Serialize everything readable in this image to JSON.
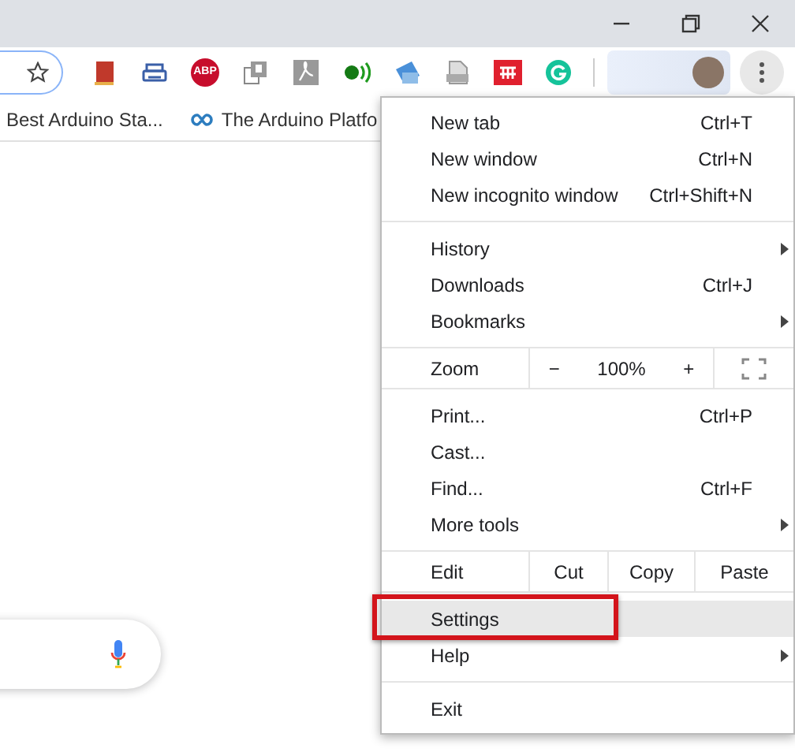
{
  "window_controls": [
    {
      "kind": "minimize"
    },
    {
      "kind": "restore"
    },
    {
      "kind": "close"
    }
  ],
  "toolbar": {
    "extensions": [
      {
        "kind": "book"
      },
      {
        "kind": "printer"
      },
      {
        "kind": "abp",
        "text": "ABP"
      },
      {
        "kind": "frames"
      },
      {
        "kind": "pdf"
      },
      {
        "kind": "signal"
      },
      {
        "kind": "screenshot"
      },
      {
        "kind": "file"
      },
      {
        "kind": "grid"
      },
      {
        "kind": "grammar"
      }
    ]
  },
  "bookmarks": [
    {
      "label": "Best Arduino Sta...",
      "icon": false
    },
    {
      "label": "The Arduino Platfo",
      "icon": true
    }
  ],
  "menu": [
    {
      "kind": "item",
      "label": "New tab",
      "shortcut": "Ctrl+T",
      "submenu": false,
      "selected": false
    },
    {
      "kind": "item",
      "label": "New window",
      "shortcut": "Ctrl+N",
      "submenu": false,
      "selected": false
    },
    {
      "kind": "item",
      "label": "New incognito window",
      "shortcut": "Ctrl+Shift+N",
      "submenu": false,
      "selected": false
    },
    {
      "kind": "separator"
    },
    {
      "kind": "item",
      "label": "History",
      "submenu": true,
      "selected": false
    },
    {
      "kind": "item",
      "label": "Downloads",
      "shortcut": "Ctrl+J",
      "submenu": false,
      "selected": false
    },
    {
      "kind": "item",
      "label": "Bookmarks",
      "submenu": true,
      "selected": false
    },
    {
      "kind": "separator"
    },
    {
      "kind": "zoom",
      "label": "Zoom",
      "minus": "−",
      "value": "100%",
      "plus": "+"
    },
    {
      "kind": "separator"
    },
    {
      "kind": "item",
      "label": "Print...",
      "shortcut": "Ctrl+P",
      "submenu": false,
      "selected": false
    },
    {
      "kind": "item",
      "label": "Cast...",
      "submenu": false,
      "selected": false
    },
    {
      "kind": "item",
      "label": "Find...",
      "shortcut": "Ctrl+F",
      "submenu": false,
      "selected": false
    },
    {
      "kind": "item",
      "label": "More tools",
      "submenu": true,
      "selected": false
    },
    {
      "kind": "separator"
    },
    {
      "kind": "edit",
      "label": "Edit",
      "actions": [
        "Cut",
        "Copy",
        "Paste"
      ]
    },
    {
      "kind": "separator"
    },
    {
      "kind": "item",
      "label": "Settings",
      "submenu": false,
      "selected": true
    },
    {
      "kind": "item",
      "label": "Help",
      "submenu": true,
      "selected": false
    },
    {
      "kind": "separator"
    },
    {
      "kind": "item",
      "label": "Exit",
      "submenu": false,
      "selected": false
    }
  ]
}
